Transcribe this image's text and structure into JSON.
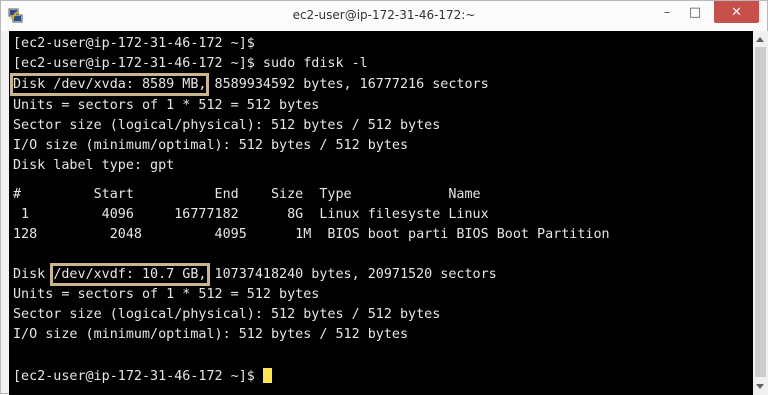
{
  "window": {
    "title": "ec2-user@ip-172-31-46-172:~",
    "minimize_glyph": "–",
    "maximize_glyph": "□",
    "close_glyph": "✕",
    "app_icon": "putty-icon"
  },
  "terminal": {
    "prompt1": "[ec2-user@ip-172-31-46-172 ~]$",
    "prompt2": "[ec2-user@ip-172-31-46-172 ~]$ sudo fdisk -l",
    "disk1_label": "Disk /dev/xvda: 8589 MB,",
    "disk1_rest": " 8589934592 bytes, 16777216 sectors",
    "units1": "Units = sectors of 1 * 512 = 512 bytes",
    "sector1": "Sector size (logical/physical): 512 bytes / 512 bytes",
    "io1": "I/O size (minimum/optimal): 512 bytes / 512 bytes",
    "label_type": "Disk label type: gpt",
    "table_header": "#         Start          End    Size  Type            Name",
    "row1": " 1         4096     16777182      8G  Linux filesyste Linux",
    "row2": "128         2048         4095      1M  BIOS boot parti BIOS Boot Partition",
    "disk2_prefix": "Disk ",
    "disk2_label": "/dev/xvdf: 10.7 GB,",
    "disk2_rest": " 10737418240 bytes, 20971520 sectors",
    "units2": "Units = sectors of 1 * 512 = 512 bytes",
    "sector2": "Sector size (logical/physical): 512 bytes / 512 bytes",
    "io2": "I/O size (minimum/optimal): 512 bytes / 512 bytes",
    "prompt_final": "[ec2-user@ip-172-31-46-172 ~]$ "
  },
  "colors": {
    "terminal_bg": "#000000",
    "terminal_fg": "#e6e6e6",
    "highlight_box": "#c9b68d",
    "cursor": "#ffe44c",
    "close_button": "#c7504a"
  }
}
